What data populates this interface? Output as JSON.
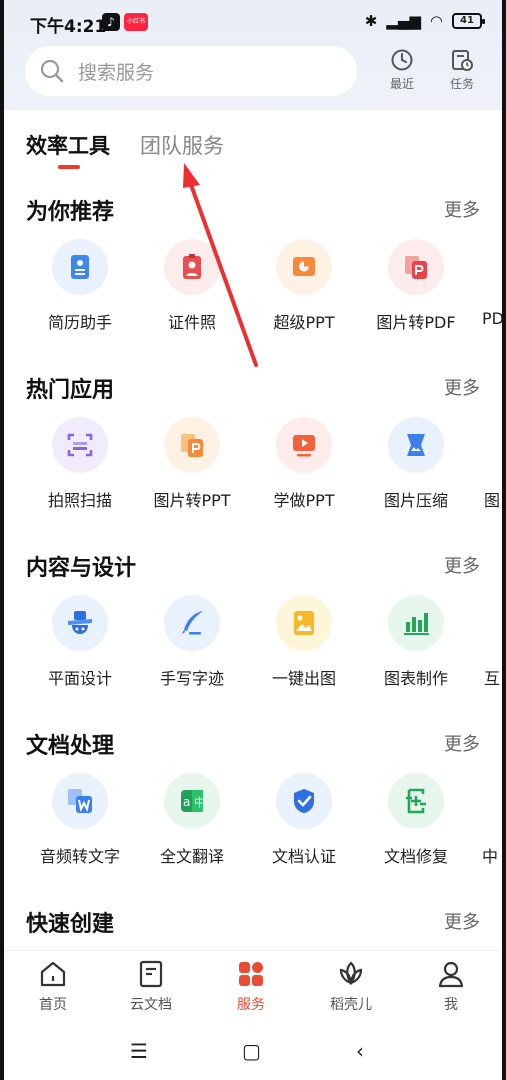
{
  "status": {
    "time": "下午4:21",
    "battery": "41"
  },
  "search": {
    "placeholder": "搜索服务"
  },
  "top_actions": [
    {
      "label": "最近"
    },
    {
      "label": "任务"
    }
  ],
  "tabs": [
    {
      "label": "效率工具"
    },
    {
      "label": "团队服务"
    }
  ],
  "sections": [
    {
      "title": "为你推荐",
      "more": "更多",
      "items": [
        "简历助手",
        "证件照",
        "超级PPT",
        "图片转PDF",
        "PD"
      ]
    },
    {
      "title": "热门应用",
      "more": "更多",
      "items": [
        "拍照扫描",
        "图片转PPT",
        "学做PPT",
        "图片压缩",
        "图"
      ]
    },
    {
      "title": "内容与设计",
      "more": "更多",
      "items": [
        "平面设计",
        "手写字迹",
        "一键出图",
        "图表制作",
        "互"
      ]
    },
    {
      "title": "文档处理",
      "more": "更多",
      "items": [
        "音频转文字",
        "全文翻译",
        "文档认证",
        "文档修复",
        "中"
      ]
    },
    {
      "title": "快速创建",
      "more": "更多"
    }
  ],
  "bottom_nav": [
    {
      "label": "首页",
      "icon": "home-icon"
    },
    {
      "label": "云文档",
      "icon": "cloud-doc-icon"
    },
    {
      "label": "服务",
      "icon": "services-icon"
    },
    {
      "label": "稻壳儿",
      "icon": "docer-icon"
    },
    {
      "label": "我",
      "icon": "profile-icon"
    }
  ],
  "colors": {
    "accent": "#e94b35",
    "tab_underline": "#e83b2b"
  }
}
